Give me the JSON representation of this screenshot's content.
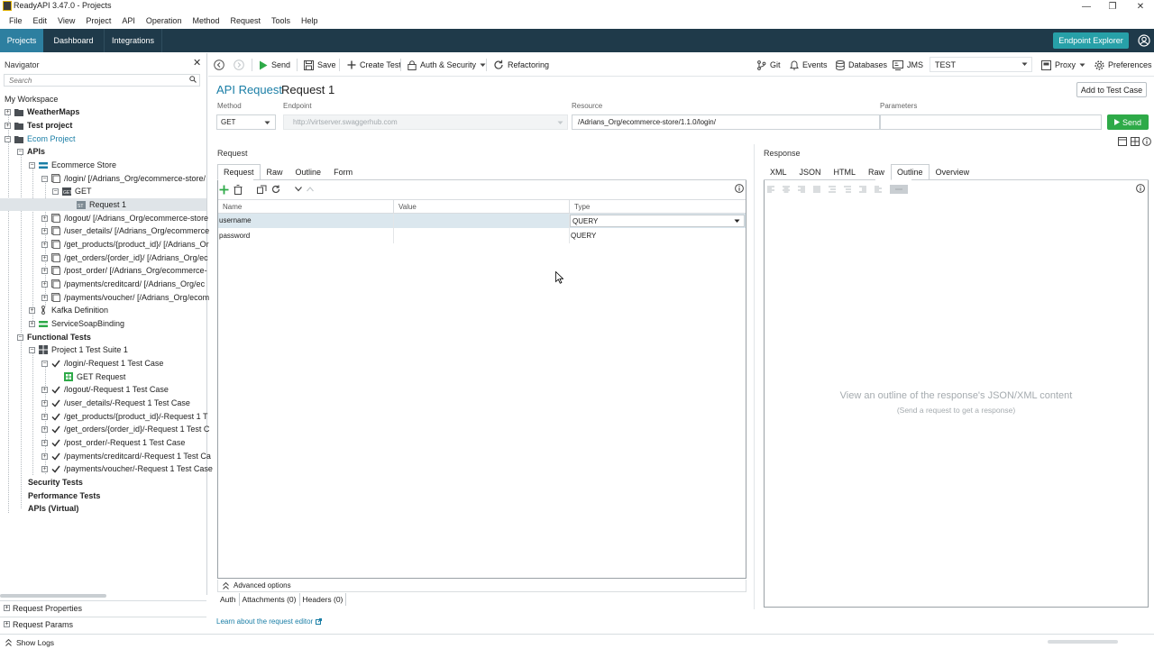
{
  "window": {
    "title": "ReadyAPI 3.47.0 - Projects",
    "minimize_icon": "minimize-icon",
    "maximize_icon": "restore-icon",
    "close_icon": "close-icon"
  },
  "menubar": [
    "File",
    "Edit",
    "View",
    "Project",
    "API",
    "Operation",
    "Method",
    "Request",
    "Tools",
    "Help"
  ],
  "topnav": {
    "tabs": [
      "Projects",
      "Dashboard",
      "Integrations"
    ],
    "active": "Projects",
    "endpoint_explorer": "Endpoint Explorer",
    "accent": "#27a0a8",
    "bg": "#1f3a4a"
  },
  "navigator": {
    "title": "Navigator",
    "search_placeholder": "Search",
    "workspace": "My Workspace",
    "tree": [
      {
        "label": "WeatherMaps",
        "bold": true
      },
      {
        "label": "Test project",
        "bold": true
      },
      {
        "label": "Ecom Project",
        "teal": true
      },
      {
        "label": "APIs",
        "bold": true
      },
      {
        "label": "Ecommerce Store"
      },
      {
        "label": "/login/ [/Adrians_Org/ecommerce-store/"
      },
      {
        "label": "GET"
      },
      {
        "label": "Request 1"
      },
      {
        "label": "/logout/ [/Adrians_Org/ecommerce-store"
      },
      {
        "label": "/user_details/ [/Adrians_Org/ecommerce"
      },
      {
        "label": "/get_products/{product_id}/ [/Adrians_Or"
      },
      {
        "label": "/get_orders/{order_id}/ [/Adrians_Org/ec"
      },
      {
        "label": "/post_order/ [/Adrians_Org/ecommerce-"
      },
      {
        "label": "/payments/creditcard/ [/Adrians_Org/ec"
      },
      {
        "label": "/payments/voucher/ [/Adrians_Org/ecom"
      },
      {
        "label": "Kafka Definition"
      },
      {
        "label": "ServiceSoapBinding"
      },
      {
        "label": "Functional Tests",
        "bold": true
      },
      {
        "label": "Project 1 Test Suite 1"
      },
      {
        "label": "/login/-Request 1 Test Case"
      },
      {
        "label": "GET Request"
      },
      {
        "label": "/logout/-Request 1 Test Case"
      },
      {
        "label": "/user_details/-Request 1 Test Case"
      },
      {
        "label": "/get_products/{product_id}/-Request 1 T"
      },
      {
        "label": "/get_orders/{order_id}/-Request 1 Test C"
      },
      {
        "label": "/post_order/-Request 1 Test Case"
      },
      {
        "label": "/payments/creditcard/-Request 1 Test Ca"
      },
      {
        "label": "/payments/voucher/-Request 1 Test Case"
      },
      {
        "label": "Security Tests",
        "bold": true
      },
      {
        "label": "Performance Tests",
        "bold": true
      },
      {
        "label": "APIs (Virtual)",
        "bold": true
      }
    ],
    "request_properties": "Request Properties",
    "request_params": "Request Params"
  },
  "toolbar": {
    "send": "Send",
    "save": "Save",
    "create_test": "Create Test",
    "auth_security": "Auth & Security",
    "refactoring": "Refactoring",
    "git": "Git",
    "events": "Events",
    "databases": "Databases",
    "jms": "JMS",
    "environment": "TEST",
    "proxy": "Proxy",
    "preferences": "Preferences"
  },
  "request": {
    "kind": "API Request",
    "name": "Request 1",
    "add_to_test_case": "Add to Test Case",
    "method_label": "Method",
    "method": "GET",
    "endpoint_label": "Endpoint",
    "endpoint": "http://virtserver.swaggerhub.com",
    "resource_label": "Resource",
    "resource": "/Adrians_Org/ecommerce-store/1.1.0/login/",
    "parameters_label": "Parameters",
    "parameters": "",
    "send": "Send",
    "section": "Request",
    "tabs": [
      "Request",
      "Raw",
      "Outline",
      "Form"
    ],
    "columns": [
      "Name",
      "Value",
      "Type"
    ],
    "rows": [
      {
        "name": "username",
        "value": "",
        "type": "QUERY"
      },
      {
        "name": "password",
        "value": "",
        "type": "QUERY"
      }
    ],
    "advanced": "Advanced options",
    "subtabs": [
      "Auth",
      "Attachments (0)",
      "Headers (0)"
    ],
    "learn": "Learn about the request editor"
  },
  "response": {
    "section": "Response",
    "tabs": [
      "XML",
      "JSON",
      "HTML",
      "Raw",
      "Outline",
      "Overview"
    ],
    "active": "Outline",
    "empty_title": "View an outline of the response's JSON/XML content",
    "empty_sub": "(Send a request to get a response)"
  },
  "status": {
    "show_logs": "Show Logs"
  }
}
